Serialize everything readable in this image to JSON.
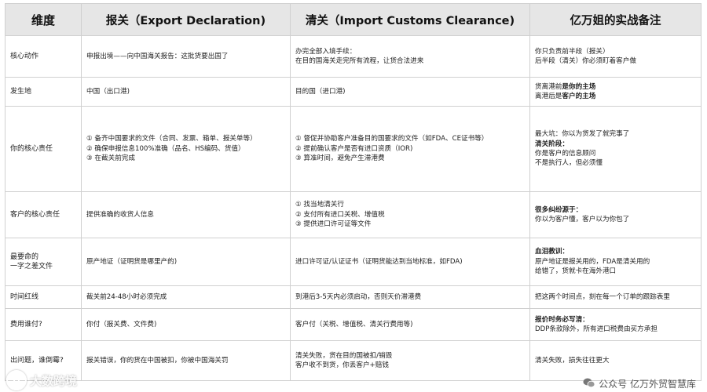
{
  "table": {
    "headers": [
      "维度",
      "报关（Export Declaration)",
      "清关（Import Customs Clearance)",
      "亿万姐的实战备注"
    ],
    "rows": [
      {
        "label": "核心动作",
        "export": [
          "申报出境——向中国海关报告：这批货要出国了"
        ],
        "import": [
          "办完全部入境手续：",
          "在目的国海关走完所有流程，让货合法进来"
        ],
        "notes": [
          {
            "text": "你只负责前半段（报关）",
            "bold": false
          },
          {
            "text": "后半段（清关）你必须盯着客户做",
            "bold": false
          }
        ]
      },
      {
        "label": "发生地",
        "export": [
          "中国（出口港)"
        ],
        "import": [
          "目的国（进口港)"
        ],
        "notes": [
          {
            "text": "货离港前",
            "bold": false,
            "suffix": "是你的主场"
          },
          {
            "text": "离港后是",
            "bold": false,
            "suffix": "客户的主场"
          }
        ]
      },
      {
        "label": "你的核心责任",
        "export": [
          "① 备齐中国要求的文件（合同、发票、箱单、报关单等）",
          "② 确保申报信息100%准确（品名、HS编码、货值）",
          "③ 在截关前完成"
        ],
        "import": [
          "① 督促并协助客户准备目的国要求的文件（如FDA、CE证书等）",
          "② 提前确认客户是否有进口资质（IOR)",
          "③ 算准时间，避免产生滞港费"
        ],
        "notes": [
          {
            "text": "最大坑：你以为货发了就完事了",
            "bold": false
          },
          {
            "text": "清关阶段：",
            "bold": true
          },
          {
            "text": "你是客户的信息顾问",
            "bold": false
          },
          {
            "text": "不是执行人，但必须懂",
            "bold": false
          }
        ]
      },
      {
        "label": "客户的核心责任",
        "export": [
          "提供准确的收货人信息"
        ],
        "import": [
          "① 找当地清关行",
          "② 支付所有进口关税、增值税",
          "③ 提供进口许可证等文件"
        ],
        "notes": [
          {
            "text": "很多纠纷源于：",
            "bold": true
          },
          {
            "text": "你以为客户懂，客户以为你包了",
            "bold": false
          }
        ]
      },
      {
        "label": "最要命的\n一字之差文件",
        "export": [
          "原产地证（证明货是哪里产的)"
        ],
        "import": [
          "进口许可证/认证证书（证明货能达到当地标准，如FDA)"
        ],
        "notes": [
          {
            "text": "血泪教训：",
            "bold": true
          },
          {
            "text": "原产地证是报关用的，FDA是清关用的",
            "bold": false
          },
          {
            "text": "给错了，货就卡在海外港口",
            "bold": false
          }
        ]
      },
      {
        "label": "时间红线",
        "export": [
          "截关前24-48小时必须完成"
        ],
        "import": [
          "到港后3-5天内必须启动，否则天价滞港费"
        ],
        "notes": [
          {
            "text": "把这两个时间点，刻在每一个订单的跟踪表里",
            "bold": false
          }
        ]
      },
      {
        "label": "费用谁付?",
        "export": [
          "你付（报关费、文件费)"
        ],
        "import": [
          "客户付（关税、增值税、清关行费用等)"
        ],
        "notes": [
          {
            "text": "报价时务必写清：",
            "bold": true
          },
          {
            "text": "DDP条款除外，所有进口税费由买方承担",
            "bold": false
          }
        ]
      },
      {
        "label": "出问题，谁倒霉?",
        "export": [
          "报关错误，你的货在中国被扣，你被中国海关罚"
        ],
        "import": [
          "清关失败，货在目的国被扣/销毁",
          "客户收不到货，你丢客户+赔钱"
        ],
        "notes": [
          {
            "text": "清关失败，损失往往更大",
            "bold": false
          }
        ]
      }
    ]
  },
  "watermarks": {
    "left_text": "大数跨境",
    "left_icon": "brand-circle-icon",
    "right_text": "公众号 亿万外贸智慧库",
    "right_icon": "wechat-icon"
  }
}
